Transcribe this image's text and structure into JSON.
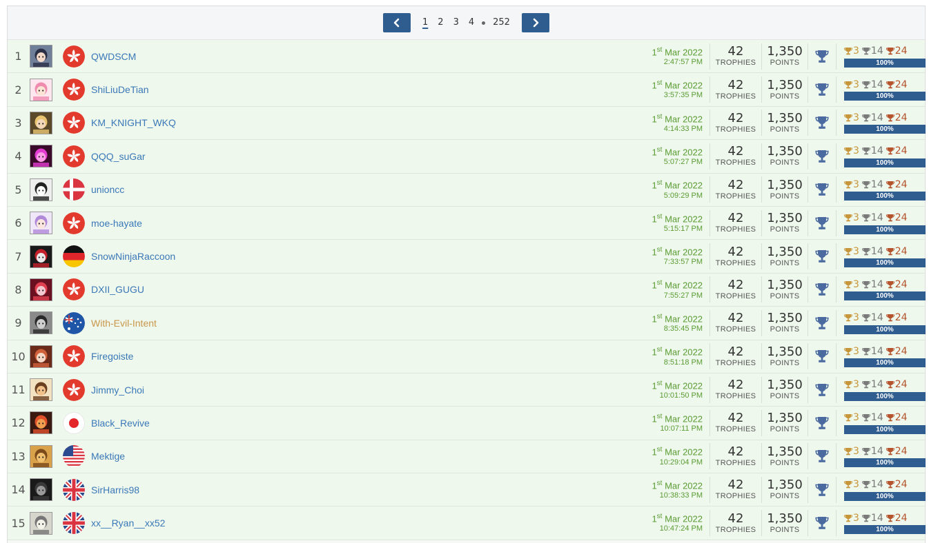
{
  "pagination": {
    "pages": [
      "1",
      "2",
      "3",
      "4"
    ],
    "current": "1",
    "last": "252"
  },
  "labels": {
    "trophies": "TROPHIES",
    "points": "POINTS",
    "month_year": "Mar 2022",
    "day": "1",
    "day_suffix": "st"
  },
  "colors": {
    "accent": "#2f5d8f",
    "link": "#3a78b8",
    "date": "#5a9b32"
  },
  "rows": [
    {
      "rank": "1",
      "name": "QWDSCM",
      "flag": "hong-kong",
      "avatar": "anime-dark",
      "time": "2:47:57 PM",
      "trophies": "42",
      "points": "1,350",
      "gold": "3",
      "silver": "14",
      "bronze": "24",
      "progress": "100%",
      "progress_value": 1.0
    },
    {
      "rank": "2",
      "name": "ShiLiuDeTian",
      "flag": "hong-kong",
      "avatar": "anime-pink",
      "time": "3:57:35 PM",
      "trophies": "42",
      "points": "1,350",
      "gold": "3",
      "silver": "14",
      "bronze": "24",
      "progress": "100%",
      "progress_value": 1.0
    },
    {
      "rank": "3",
      "name": "KM_KNIGHT_WKQ",
      "flag": "hong-kong",
      "avatar": "blonde-knight",
      "time": "4:14:33 PM",
      "trophies": "42",
      "points": "1,350",
      "gold": "3",
      "silver": "14",
      "bronze": "24",
      "progress": "100%",
      "progress_value": 1.0
    },
    {
      "rank": "4",
      "name": "QQQ_suGar",
      "flag": "hong-kong",
      "avatar": "magenta-glow",
      "time": "5:07:27 PM",
      "trophies": "42",
      "points": "1,350",
      "gold": "3",
      "silver": "14",
      "bronze": "24",
      "progress": "100%",
      "progress_value": 1.0
    },
    {
      "rank": "5",
      "name": "unioncc",
      "flag": "denmark",
      "avatar": "white-face",
      "time": "5:09:29 PM",
      "trophies": "42",
      "points": "1,350",
      "gold": "3",
      "silver": "14",
      "bronze": "24",
      "progress": "100%",
      "progress_value": 1.0
    },
    {
      "rank": "6",
      "name": "moe-hayate",
      "flag": "hong-kong",
      "avatar": "anime-lilac",
      "time": "5:15:17 PM",
      "trophies": "42",
      "points": "1,350",
      "gold": "3",
      "silver": "14",
      "bronze": "24",
      "progress": "100%",
      "progress_value": 1.0
    },
    {
      "rank": "7",
      "name": "SnowNinjaRaccoon",
      "flag": "germany",
      "avatar": "red-ninja",
      "time": "7:33:57 PM",
      "trophies": "42",
      "points": "1,350",
      "gold": "3",
      "silver": "14",
      "bronze": "24",
      "progress": "100%",
      "progress_value": 1.0
    },
    {
      "rank": "8",
      "name": "DXII_GUGU",
      "flag": "hong-kong",
      "avatar": "crest",
      "time": "7:55:27 PM",
      "trophies": "42",
      "points": "1,350",
      "gold": "3",
      "silver": "14",
      "bronze": "24",
      "progress": "100%",
      "progress_value": 1.0
    },
    {
      "rank": "9",
      "name": "With-Evil-Intent",
      "flag": "australia",
      "avatar": "grey-figure",
      "time": "8:35:45 PM",
      "trophies": "42",
      "points": "1,350",
      "gold": "3",
      "silver": "14",
      "bronze": "24",
      "progress": "100%",
      "progress_value": 1.0,
      "alt": true
    },
    {
      "rank": "10",
      "name": "Firegoiste",
      "flag": "hong-kong",
      "avatar": "anime-brown",
      "time": "8:51:18 PM",
      "trophies": "42",
      "points": "1,350",
      "gold": "3",
      "silver": "14",
      "bronze": "24",
      "progress": "100%",
      "progress_value": 1.0
    },
    {
      "rank": "11",
      "name": "Jimmy_Choi",
      "flag": "hong-kong",
      "avatar": "cartoon-kid",
      "time": "10:01:50 PM",
      "trophies": "42",
      "points": "1,350",
      "gold": "3",
      "silver": "14",
      "bronze": "24",
      "progress": "100%",
      "progress_value": 1.0
    },
    {
      "rank": "12",
      "name": "Black_Revive",
      "flag": "japan",
      "avatar": "fire-scene",
      "time": "10:07:11 PM",
      "trophies": "42",
      "points": "1,350",
      "gold": "3",
      "silver": "14",
      "bronze": "24",
      "progress": "100%",
      "progress_value": 1.0
    },
    {
      "rank": "13",
      "name": "Mektige",
      "flag": "usa",
      "avatar": "orange-cat",
      "time": "10:29:04 PM",
      "trophies": "42",
      "points": "1,350",
      "gold": "3",
      "silver": "14",
      "bronze": "24",
      "progress": "100%",
      "progress_value": 1.0
    },
    {
      "rank": "14",
      "name": "SirHarris98",
      "flag": "uk",
      "avatar": "dark-hood",
      "time": "10:38:33 PM",
      "trophies": "42",
      "points": "1,350",
      "gold": "3",
      "silver": "14",
      "bronze": "24",
      "progress": "100%",
      "progress_value": 1.0
    },
    {
      "rank": "15",
      "name": "xx__Ryan__xx52",
      "flag": "uk",
      "avatar": "robot-head",
      "time": "10:47:24 PM",
      "trophies": "42",
      "points": "1,350",
      "gold": "3",
      "silver": "14",
      "bronze": "24",
      "progress": "100%",
      "progress_value": 1.0
    }
  ]
}
